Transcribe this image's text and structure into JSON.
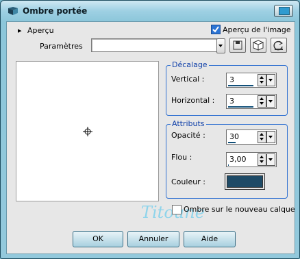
{
  "window": {
    "title": "Ombre portée"
  },
  "preview_section": {
    "label": "Aperçu",
    "image_preview_checkbox": {
      "label": "Aperçu de l'image",
      "checked": true
    }
  },
  "params": {
    "label": "Paramètres",
    "value": ""
  },
  "offset": {
    "title": "Décalage",
    "vertical": {
      "label": "Vertical :",
      "value": "3"
    },
    "horizontal": {
      "label": "Horizontal :",
      "value": "3"
    }
  },
  "attributes": {
    "title": "Attributs",
    "opacity": {
      "label": "Opacité :",
      "value": "30"
    },
    "blur": {
      "label": "Flou :",
      "value": "3,00"
    },
    "color": {
      "label": "Couleur :",
      "value": "#1e4a66"
    }
  },
  "new_layer": {
    "label": "Ombre sur le nouveau calque",
    "checked": false
  },
  "watermark": {
    "text": "Titoune"
  },
  "buttons": {
    "ok": "OK",
    "cancel": "Annuler",
    "help": "Aide"
  },
  "colors": {
    "accent": "#2d6fd0",
    "title_text": "#0d3ea8",
    "swatch": "#1e4a66"
  }
}
